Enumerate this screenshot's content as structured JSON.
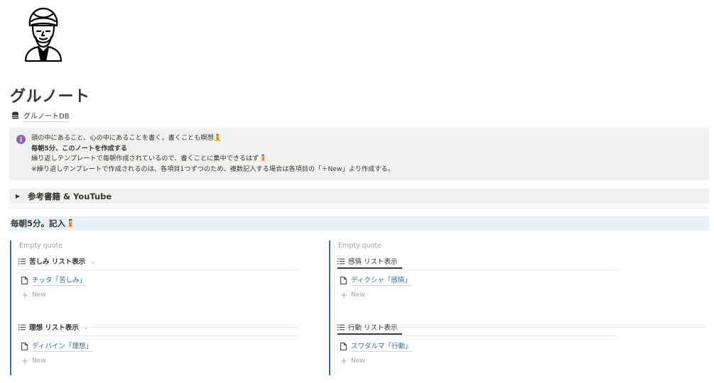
{
  "page": {
    "title": "グルノート",
    "database_link": "グルノートDB"
  },
  "callout": {
    "line1": "頭の中にあること、心の中にあることを書く。書くことも瞑想🧘",
    "line2": "毎朝5分、このノートを作成する",
    "line3": "繰り返しテンプレートで毎朝作成されているので、書くことに集中できるはず🧘🏻",
    "line4": "※繰り返しテンプレートで作成されるのは、各項目1つずつのため、複数記入する場合は各項目の「＋New」より作成する。"
  },
  "toggle": {
    "label": "参考書籍 & YouTube"
  },
  "section": {
    "heading": "毎朝5分。記入🧘🏻"
  },
  "columns": {
    "left": {
      "placeholder": "Empty quote",
      "views": [
        {
          "title": "苦しみ リスト表示",
          "chevron": "⌄",
          "item": "チッタ「苦しみ」",
          "new_label": "New"
        },
        {
          "title": "理想 リスト表示",
          "chevron": "⌄",
          "item": "ディバイン「理想」",
          "new_label": "New"
        }
      ]
    },
    "right": {
      "placeholder": "Empty quote",
      "views": [
        {
          "title": "感情 リスト表示",
          "item": "ディクシャ「感情」",
          "new_label": "New"
        },
        {
          "title": "行動 リスト表示",
          "item": "スワダルマ「行動」",
          "new_label": "New"
        }
      ]
    }
  },
  "icons": {
    "avatar": "turbaned-guru-avatar",
    "database": "database-icon",
    "callout": "info-icon",
    "toggle": "triangle-right-icon",
    "view": "list-icon",
    "page": "page-icon",
    "new": "plus-icon"
  },
  "colors": {
    "callout_bg": "#f1f1ef",
    "heading_bg": "#e7f3f8",
    "quote_bar": "#3f6e9a",
    "link": "#2e6b9e",
    "info_icon": "#9065b0"
  }
}
